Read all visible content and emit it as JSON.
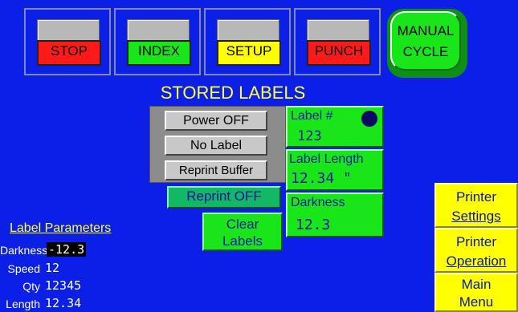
{
  "top_buttons": [
    {
      "label": "STOP"
    },
    {
      "label": "INDEX"
    },
    {
      "label": "SETUP"
    },
    {
      "label": "PUNCH"
    }
  ],
  "manual_cycle": {
    "line1": "MANUAL",
    "line2": "CYCLE"
  },
  "title": "STORED LABELS",
  "controls": {
    "power": "Power OFF",
    "no_label": "No Label",
    "reprint_buffer": "Reprint Buffer",
    "reprint_off": "Reprint OFF",
    "clear_line1": "Clear",
    "clear_line2": "Labels"
  },
  "info": {
    "label_num_title": "Label #",
    "label_num_value": "123",
    "label_length_title": "Label Length",
    "label_length_value": "12.34 \"",
    "darkness_title": "Darkness",
    "darkness_value": "12.3"
  },
  "right_buttons": [
    {
      "line1": "Printer",
      "line2": "Settings"
    },
    {
      "line1": "Printer",
      "line2": "Operation"
    },
    {
      "line1": "Main",
      "line2": "Menu"
    }
  ],
  "label_params": {
    "title": "Label Parameters",
    "rows": [
      {
        "label": "Darkness",
        "value": "-12.3"
      },
      {
        "label": "Speed",
        "value": "12"
      },
      {
        "label": "Qty",
        "value": "12345"
      },
      {
        "label": "Length",
        "value": "12.34"
      }
    ]
  }
}
